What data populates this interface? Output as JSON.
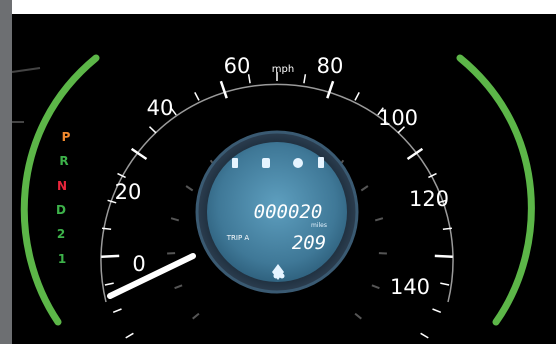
{
  "speedometer": {
    "unit_label": "mph",
    "speed_labels": [
      "0",
      "20",
      "40",
      "60",
      "80",
      "100",
      "120",
      "140"
    ],
    "needle_value_mph": 0,
    "needle_color": "#ffffff",
    "arc_color": "#5cb648"
  },
  "gear_indicator": {
    "positions": [
      {
        "label": "P",
        "color": "#f0892f",
        "active": true
      },
      {
        "label": "R",
        "color": "#3db24a",
        "active": false
      },
      {
        "label": "N",
        "color": "#e8253b",
        "active": false
      },
      {
        "label": "D",
        "color": "#3db24a",
        "active": false
      },
      {
        "label": "2",
        "color": "#3db24a",
        "active": false
      },
      {
        "label": "1",
        "color": "#3db24a",
        "active": false
      }
    ]
  },
  "info_display": {
    "odometer_value": "000020",
    "odometer_unit": "miles",
    "trip_label": "TRIP A",
    "trip_value": "209",
    "screen_color": "#4a86a8"
  },
  "top_banner": {
    "text": ""
  }
}
